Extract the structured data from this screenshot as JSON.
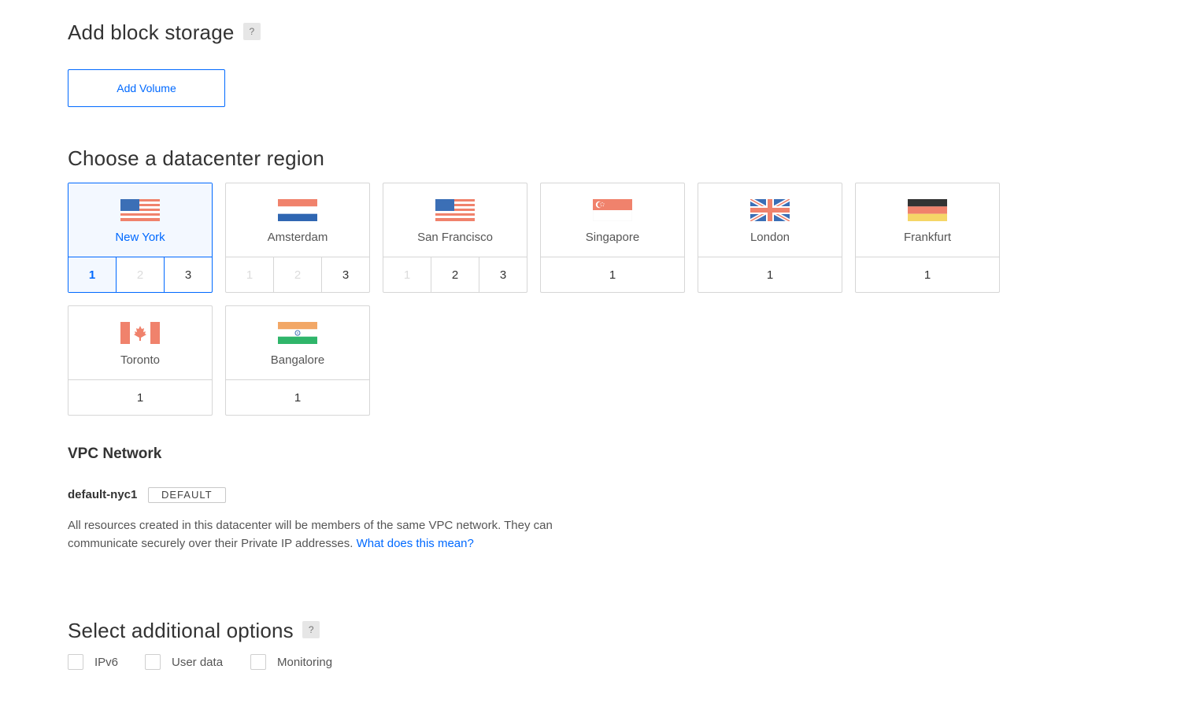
{
  "block_storage": {
    "title": "Add block storage",
    "help": "?",
    "add_volume_label": "Add Volume"
  },
  "datacenter": {
    "title": "Choose a datacenter region",
    "regions": [
      {
        "name": "New York",
        "flag": "us-flag",
        "numbers": [
          "1",
          "2",
          "3"
        ],
        "selected": true,
        "active_number": "1",
        "disabled_numbers": [
          "2"
        ]
      },
      {
        "name": "Amsterdam",
        "flag": "nl-flag",
        "numbers": [
          "1",
          "2",
          "3"
        ],
        "disabled_numbers": [
          "1",
          "2"
        ]
      },
      {
        "name": "San Francisco",
        "flag": "us-flag",
        "numbers": [
          "1",
          "2",
          "3"
        ],
        "disabled_numbers": [
          "1"
        ]
      },
      {
        "name": "Singapore",
        "flag": "sg-flag",
        "numbers": [
          "1"
        ]
      },
      {
        "name": "London",
        "flag": "uk-flag",
        "numbers": [
          "1"
        ]
      },
      {
        "name": "Frankfurt",
        "flag": "de-flag",
        "numbers": [
          "1"
        ]
      },
      {
        "name": "Toronto",
        "flag": "ca-flag",
        "numbers": [
          "1"
        ]
      },
      {
        "name": "Bangalore",
        "flag": "in-flag",
        "numbers": [
          "1"
        ]
      }
    ]
  },
  "vpc": {
    "title": "VPC Network",
    "network_name": "default-nyc1",
    "badge": "DEFAULT",
    "description": "All resources created in this datacenter will be members of the same VPC network. They can communicate securely over their Private IP addresses.",
    "link_text": "What does this mean?"
  },
  "options": {
    "title": "Select additional options",
    "help": "?",
    "items": [
      "IPv6",
      "User data",
      "Monitoring"
    ]
  },
  "colors": {
    "accent": "#0069ff",
    "selected_bg": "#f3f8ff",
    "border": "#d6d6d6"
  }
}
